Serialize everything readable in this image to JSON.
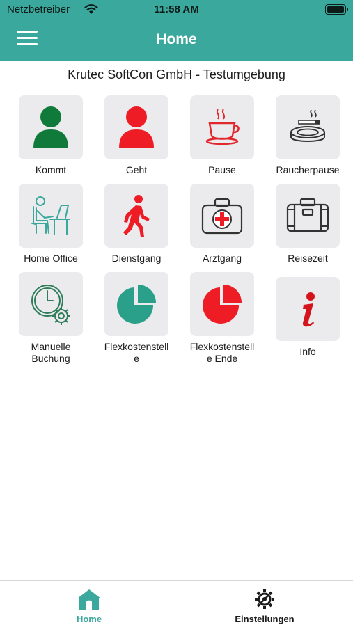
{
  "status_bar": {
    "carrier": "Netzbetreiber",
    "time": "11:58 AM"
  },
  "navbar": {
    "title": "Home",
    "subtitle": "Krutec SoftCon GmbH - Testumgebung"
  },
  "tiles": [
    {
      "label": "Kommt",
      "icon": "person-icon-green"
    },
    {
      "label": "Geht",
      "icon": "person-icon-red"
    },
    {
      "label": "Pause",
      "icon": "coffee-cup-icon"
    },
    {
      "label": "Raucherpause",
      "icon": "ashtray-icon"
    },
    {
      "label": "Home Office",
      "icon": "desk-worker-icon"
    },
    {
      "label": "Dienstgang",
      "icon": "walking-person-icon"
    },
    {
      "label": "Arztgang",
      "icon": "medical-kit-icon"
    },
    {
      "label": "Reisezeit",
      "icon": "suitcase-icon"
    },
    {
      "label": "Manuelle\nBuchung",
      "icon": "clock-gear-icon"
    },
    {
      "label": "Flexkostenstell\ne",
      "icon": "pie-chart-icon-green"
    },
    {
      "label": "Flexkostenstell\ne Ende",
      "icon": "pie-chart-icon-red"
    },
    {
      "label": "Info",
      "icon": "info-icon"
    }
  ],
  "tabbar": {
    "home_label": "Home",
    "settings_label": "Einstellungen"
  },
  "colors": {
    "accent": "#3aa89c",
    "green": "#0f7a3a",
    "red": "#ee1c25",
    "tile_bg": "#ebebed"
  }
}
